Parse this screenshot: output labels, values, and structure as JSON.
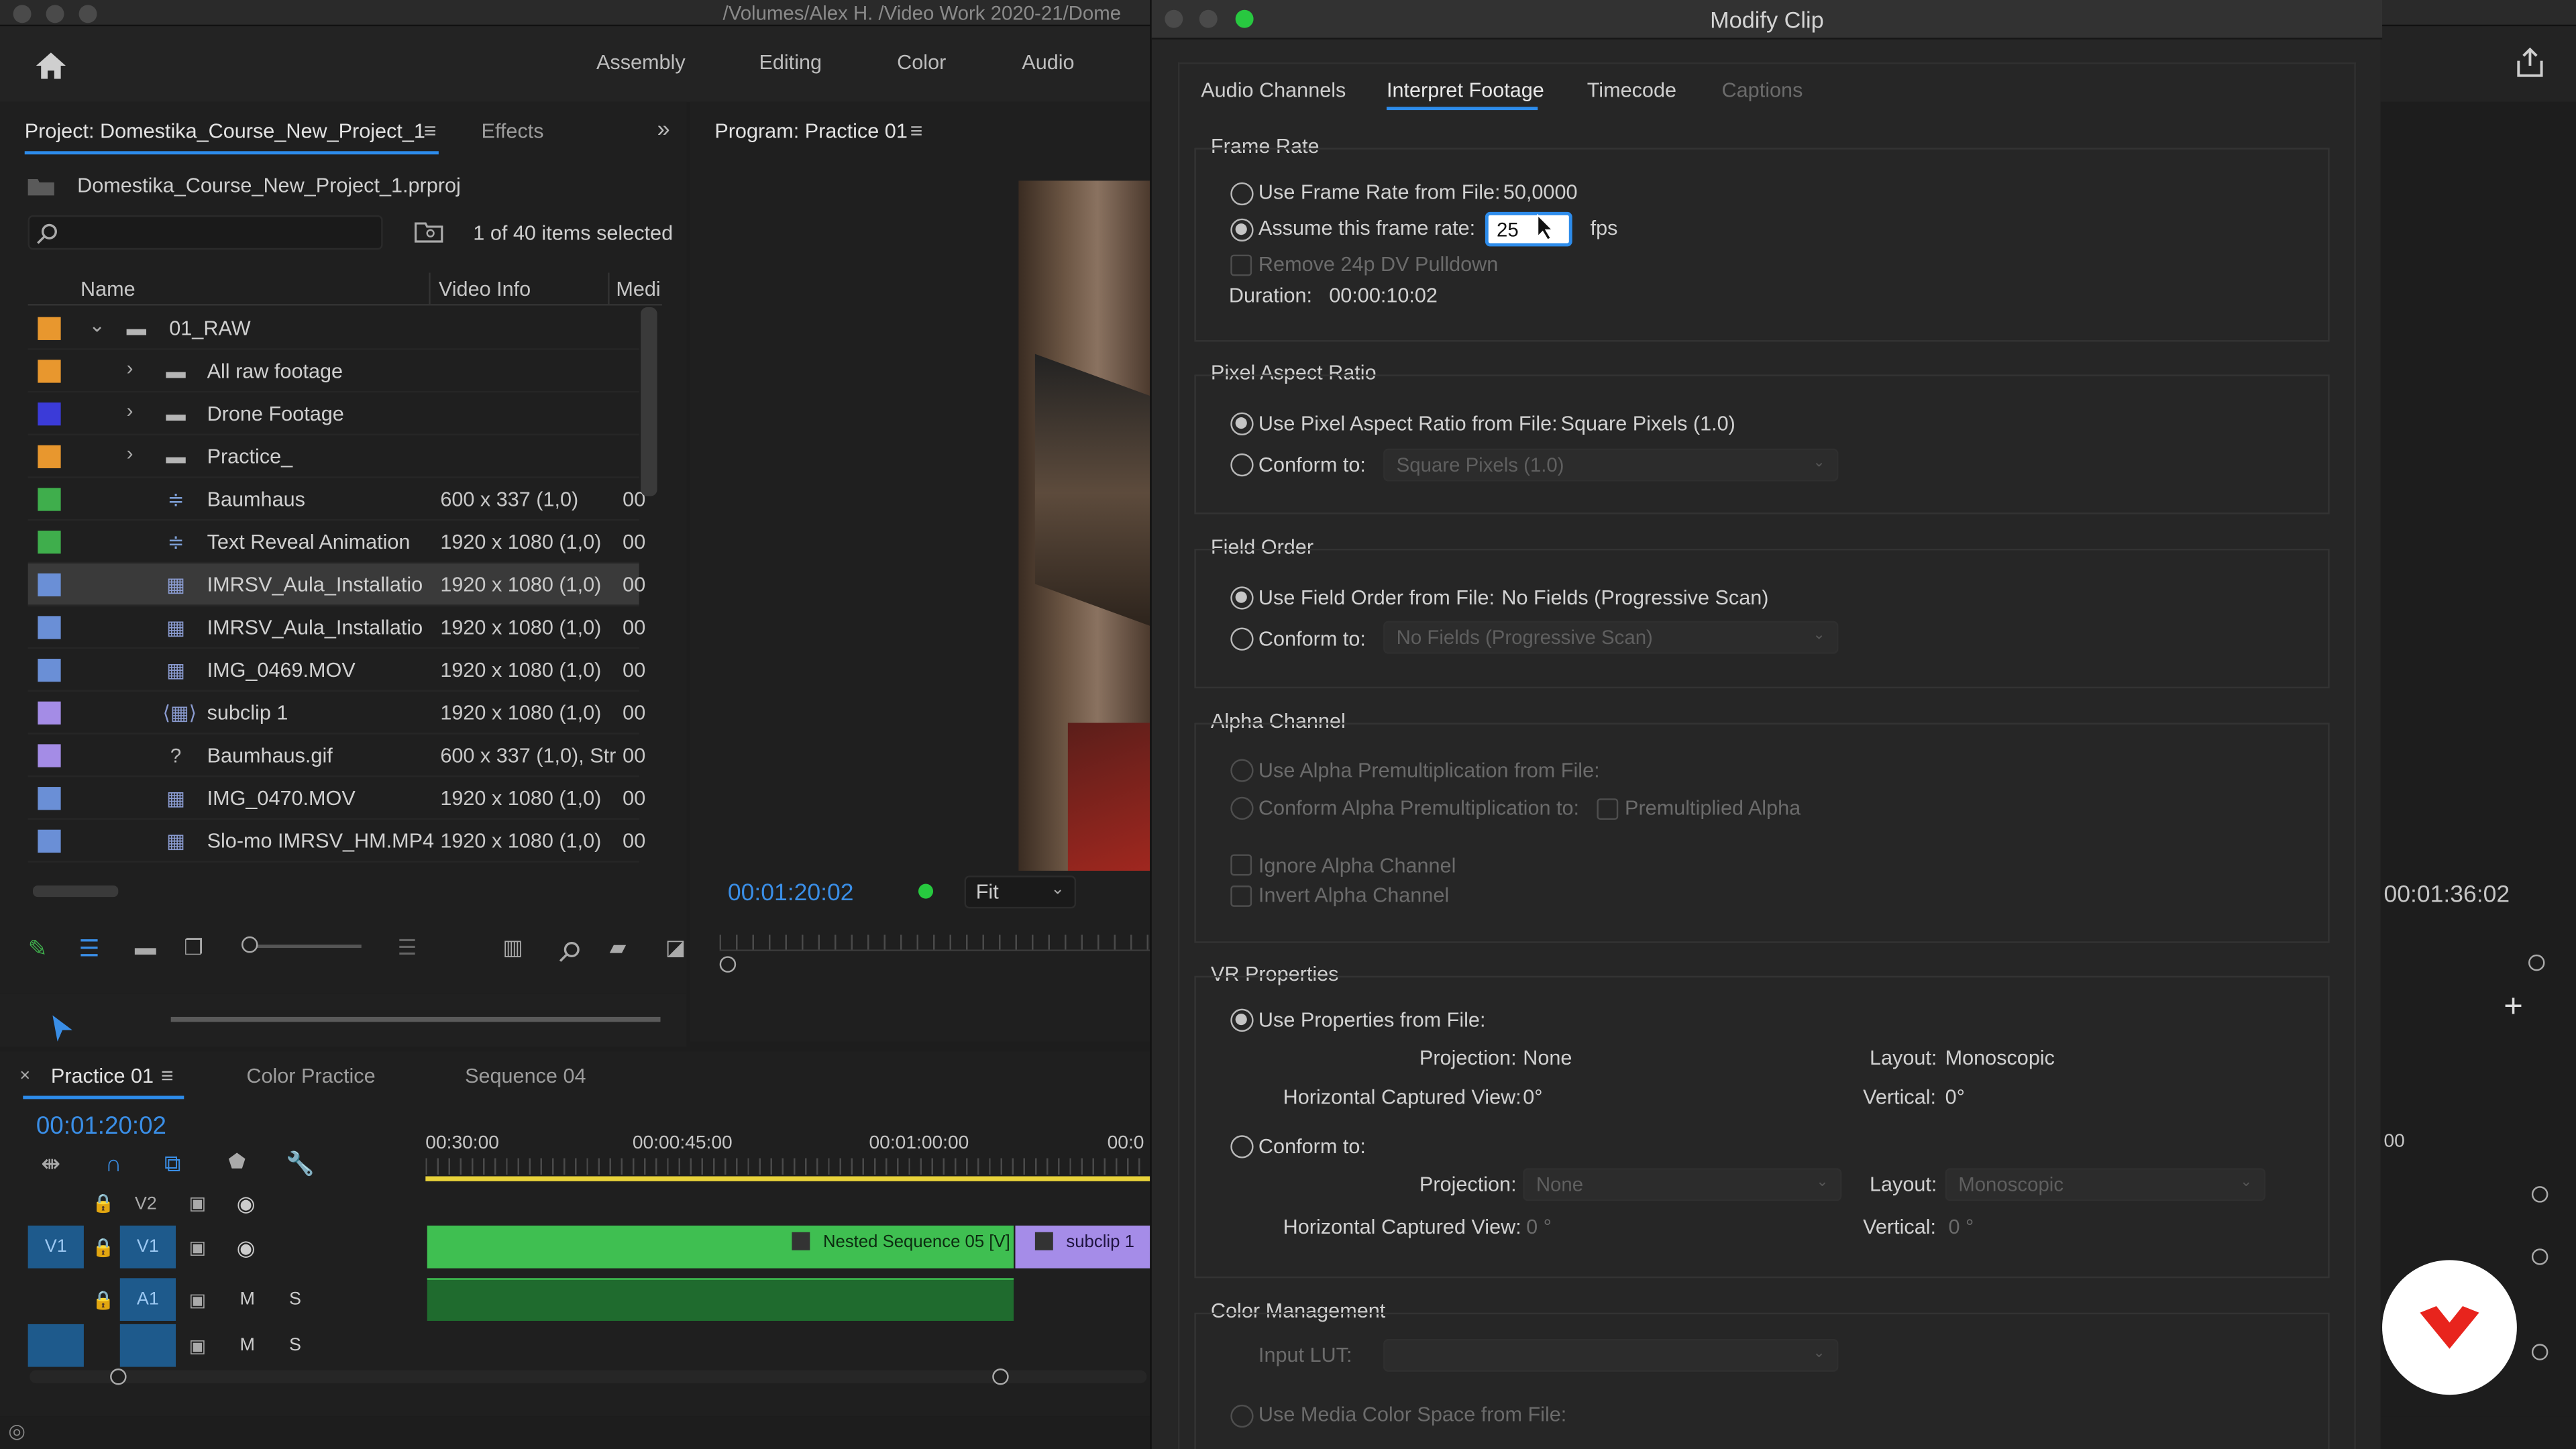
{
  "titlebar": {
    "path": "/Volumes/Alex H. /Video Work 2020-21/Dome"
  },
  "workspaces": [
    "Assembly",
    "Editing",
    "Color",
    "Audio"
  ],
  "project": {
    "tab_label": "Project: Domestika_Course_New_Project_1",
    "effects_label": "Effects",
    "file_name": "Domestika_Course_New_Project_1.prproj",
    "search_placeholder": "",
    "items_count": "1 of 40 items selected",
    "columns": {
      "name": "Name",
      "video_info": "Video Info",
      "media": "Medi"
    },
    "rows": [
      {
        "name": "01_RAW",
        "video_info": "",
        "media": "",
        "color": "#e8972e",
        "icon": "folder"
      },
      {
        "name": "All raw footage",
        "video_info": "",
        "media": "",
        "color": "#e8972e",
        "icon": "folder"
      },
      {
        "name": "Drone Footage",
        "video_info": "",
        "media": "",
        "color": "#3b3bd8",
        "icon": "folder"
      },
      {
        "name": "Practice_",
        "video_info": "",
        "media": "",
        "color": "#e8972e",
        "icon": "folder"
      },
      {
        "name": "Baumhaus",
        "video_info": "600 x 337 (1,0)",
        "media": "00",
        "color": "#3fae4c",
        "icon": "sequence"
      },
      {
        "name": "Text Reveal Animation",
        "video_info": "1920 x 1080 (1,0)",
        "media": "00",
        "color": "#3fae4c",
        "icon": "sequence"
      },
      {
        "name": "IMRSV_Aula_Installatio",
        "video_info": "1920 x 1080 (1,0)",
        "media": "00",
        "color": "#6a8fd6",
        "icon": "clip"
      },
      {
        "name": "IMRSV_Aula_Installatio",
        "video_info": "1920 x 1080 (1,0)",
        "media": "00",
        "color": "#6a8fd6",
        "icon": "clip"
      },
      {
        "name": "IMG_0469.MOV",
        "video_info": "1920 x 1080 (1,0)",
        "media": "00",
        "color": "#6a8fd6",
        "icon": "clip"
      },
      {
        "name": "subclip 1",
        "video_info": "1920 x 1080 (1,0)",
        "media": "00",
        "color": "#a48ce6",
        "icon": "subclip"
      },
      {
        "name": "Baumhaus.gif",
        "video_info": "600 x 337 (1,0), Str",
        "media": "00",
        "color": "#a48ce6",
        "icon": "unknown"
      },
      {
        "name": "IMG_0470.MOV",
        "video_info": "1920 x 1080 (1,0)",
        "media": "00",
        "color": "#6a8fd6",
        "icon": "clip"
      },
      {
        "name": "Slo-mo IMRSV_HM.MP4",
        "video_info": "1920 x 1080 (1,0)",
        "media": "00",
        "color": "#6a8fd6",
        "icon": "clip"
      }
    ]
  },
  "program": {
    "tab_label": "Program: Practice 01",
    "timecode": "00:01:20:02",
    "fit": "Fit",
    "right_timecode": "00:01:36:02"
  },
  "timeline": {
    "tabs": [
      "Practice 01",
      "Color Practice",
      "Sequence 04"
    ],
    "timecode": "00:01:20:02",
    "ruler": [
      "00:30:00",
      "00:00:45:00",
      "00:01:00:00",
      "00:0"
    ],
    "right_ruler": "00",
    "tracks": {
      "v2": "V2",
      "v1": "V1",
      "a1": "A1",
      "m": "M",
      "s": "S"
    },
    "clips": {
      "nested": "Nested Sequence 05 [V]",
      "subclip": "subclip 1"
    }
  },
  "dialog": {
    "title": "Modify Clip",
    "tabs": [
      "Audio Channels",
      "Interpret Footage",
      "Timecode",
      "Captions"
    ],
    "frame_rate": {
      "header": "Frame Rate",
      "use_file": "Use Frame Rate from File:",
      "file_value": "50,0000",
      "assume": "Assume this frame rate:",
      "assume_value": "25",
      "unit": "fps",
      "pulldown": "Remove 24p DV Pulldown",
      "duration_label": "Duration:",
      "duration_value": "00:00:10:02"
    },
    "pixel_aspect": {
      "header": "Pixel Aspect Ratio",
      "use_file": "Use Pixel Aspect Ratio from File:",
      "file_value": "Square Pixels (1.0)",
      "conform": "Conform to:",
      "conform_value": "Square Pixels (1.0)"
    },
    "field_order": {
      "header": "Field Order",
      "use_file": "Use Field Order from File:",
      "file_value": "No Fields (Progressive Scan)",
      "conform": "Conform to:",
      "conform_value": "No Fields (Progressive Scan)"
    },
    "alpha": {
      "header": "Alpha Channel",
      "use_file": "Use Alpha Premultiplication from File:",
      "conform": "Conform Alpha Premultiplication to:",
      "premult": "Premultiplied Alpha",
      "ignore": "Ignore Alpha Channel",
      "invert": "Invert Alpha Channel"
    },
    "vr": {
      "header": "VR Properties",
      "use_file": "Use Properties from File:",
      "projection_label": "Projection:",
      "projection_value": "None",
      "layout_label": "Layout:",
      "layout_value": "Monoscopic",
      "hview_label": "Horizontal Captured View:",
      "hview_value": "0°",
      "vertical_label": "Vertical:",
      "vertical_value": "0°",
      "conform": "Conform to:",
      "c_projection_value": "None",
      "c_layout_value": "Monoscopic",
      "c_hview_value": "0 °",
      "c_vertical_value": "0 °"
    },
    "color": {
      "header": "Color Management",
      "input_lut": "Input LUT:",
      "use_media": "Use Media Color Space from File:"
    }
  }
}
